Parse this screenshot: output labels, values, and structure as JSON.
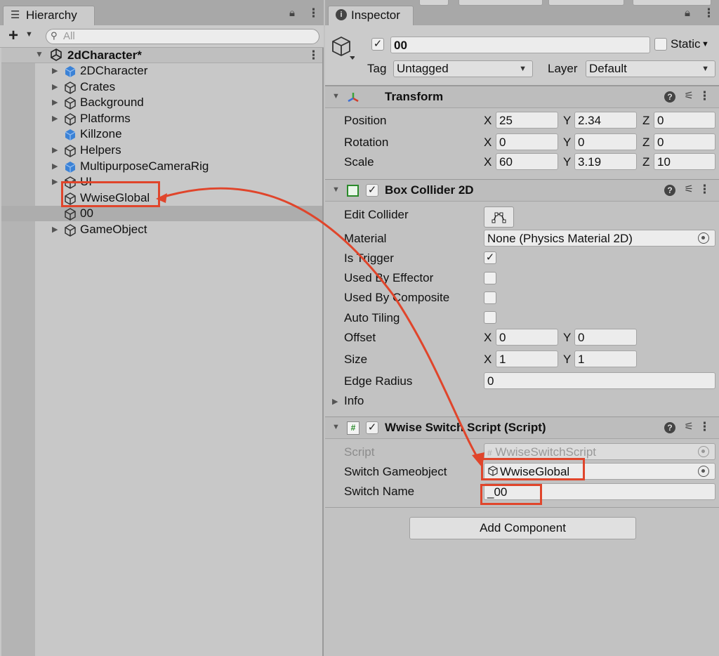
{
  "hierarchy": {
    "tab_label": "Hierarchy",
    "search_placeholder": "All",
    "scene_name": "2dCharacter*",
    "items": [
      {
        "name": "2DCharacter",
        "icon": "prefab-cube-blue",
        "expandable": true
      },
      {
        "name": "Crates",
        "icon": "cube-outline",
        "expandable": true
      },
      {
        "name": "Background",
        "icon": "cube-outline",
        "expandable": true
      },
      {
        "name": "Platforms",
        "icon": "cube-outline",
        "expandable": true
      },
      {
        "name": "Killzone",
        "icon": "prefab-cube-blue",
        "expandable": false
      },
      {
        "name": "Helpers",
        "icon": "cube-outline",
        "expandable": true
      },
      {
        "name": "MultipurposeCameraRig",
        "icon": "prefab-cube-blue",
        "expandable": true
      },
      {
        "name": "UI",
        "icon": "cube-outline",
        "expandable": true
      },
      {
        "name": "WwiseGlobal",
        "icon": "cube-outline",
        "expandable": false
      },
      {
        "name": "00",
        "icon": "cube-outline",
        "expandable": false,
        "selected": true
      },
      {
        "name": "GameObject",
        "icon": "cube-outline",
        "expandable": true
      }
    ]
  },
  "inspector": {
    "tab_label": "Inspector",
    "object_name": "00",
    "static_label": "Static",
    "tag_label": "Tag",
    "tag_value": "Untagged",
    "layer_label": "Layer",
    "layer_value": "Default",
    "transform": {
      "title": "Transform",
      "position_label": "Position",
      "rotation_label": "Rotation",
      "scale_label": "Scale",
      "position": {
        "x": "25",
        "y": "2.34",
        "z": "0"
      },
      "rotation": {
        "x": "0",
        "y": "0",
        "z": "0"
      },
      "scale": {
        "x": "60",
        "y": "3.19",
        "z": "10"
      }
    },
    "box_collider": {
      "title": "Box Collider 2D",
      "edit_collider_label": "Edit Collider",
      "material_label": "Material",
      "material_value": "None (Physics Material 2D)",
      "is_trigger_label": "Is Trigger",
      "is_trigger": true,
      "used_by_effector_label": "Used By Effector",
      "used_by_composite_label": "Used By Composite",
      "auto_tiling_label": "Auto Tiling",
      "offset_label": "Offset",
      "offset": {
        "x": "0",
        "y": "0"
      },
      "size_label": "Size",
      "size": {
        "x": "1",
        "y": "1"
      },
      "edge_radius_label": "Edge Radius",
      "edge_radius": "0",
      "info_label": "Info"
    },
    "wwise_script": {
      "title": "Wwise Switch Script (Script)",
      "script_label": "Script",
      "script_value": "WwiseSwitchScript",
      "switch_gameobject_label": "Switch Gameobject",
      "switch_gameobject_value": "WwiseGlobal",
      "switch_name_label": "Switch Name",
      "switch_name_value": "_00"
    },
    "add_component_label": "Add Component"
  },
  "axes": {
    "x": "X",
    "y": "Y",
    "z": "Z"
  },
  "colors": {
    "annotation_red": "#e0452b",
    "prefab_blue": "#3b82d6"
  }
}
